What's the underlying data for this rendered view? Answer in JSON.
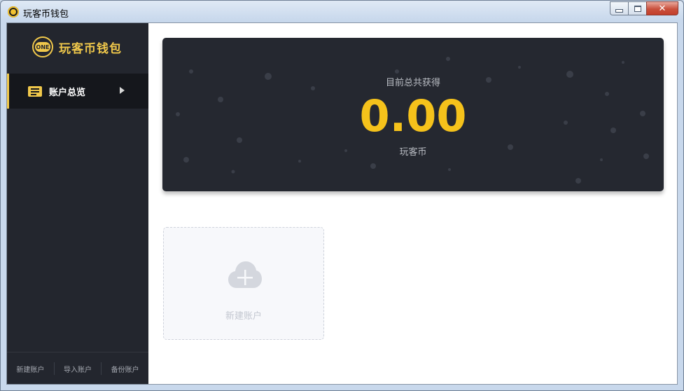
{
  "window": {
    "title": "玩客币钱包",
    "icon": "app-coin-icon",
    "controls": {
      "minimize_icon": "minimize-icon",
      "maximize_icon": "maximize-icon",
      "close_glyph": "✕"
    }
  },
  "sidebar": {
    "logo": {
      "badge_text": "ONE",
      "text": "玩客币钱包"
    },
    "items": [
      {
        "label": "账户总览",
        "icon": "list-icon",
        "active": true
      }
    ],
    "footer": [
      "新建账户",
      "导入账户",
      "备份账户"
    ]
  },
  "summary": {
    "label": "目前总共获得",
    "value": "0.00",
    "unit": "玩客币"
  },
  "new_account": {
    "label": "新建账户",
    "icon": "cloud-plus-icon"
  },
  "colors": {
    "accent": "#f5c21b",
    "sidebar_bg": "#23262e",
    "active_bg": "#15171c",
    "card_bg": "#252830"
  }
}
